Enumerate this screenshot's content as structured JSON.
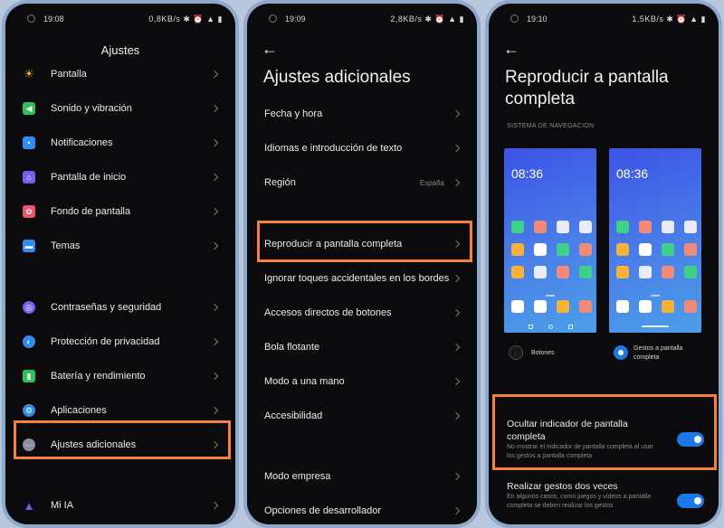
{
  "phone1": {
    "status": {
      "time": "19:08",
      "right": "0,8KB/s ✱ ⏰ ▲ ▮"
    },
    "title": "Ajustes",
    "items": [
      {
        "label": "Pantalla",
        "icon": "sun-icon",
        "color": "#f2b21b"
      },
      {
        "label": "Sonido y vibración",
        "icon": "speaker-icon",
        "color": "#2fbf5b"
      },
      {
        "label": "Notificaciones",
        "icon": "notification-icon",
        "color": "#2f8cf2"
      },
      {
        "label": "Pantalla de inicio",
        "icon": "home-icon",
        "color": "#7b5cf0"
      },
      {
        "label": "Fondo de pantalla",
        "icon": "flower-icon",
        "color": "#f0536a"
      },
      {
        "label": "Temas",
        "icon": "theme-icon",
        "color": "#2f8cf2"
      },
      {
        "label": "Contraseñas y seguridad",
        "icon": "fingerprint-icon",
        "color": "#7b5cf0"
      },
      {
        "label": "Protección de privacidad",
        "icon": "shield-icon",
        "color": "#2f8cf2"
      },
      {
        "label": "Batería y rendimiento",
        "icon": "battery-icon",
        "color": "#2fbf5b"
      },
      {
        "label": "Aplicaciones",
        "icon": "gear-icon",
        "color": "#2f8cf2"
      },
      {
        "label": "Ajustes adicionales",
        "icon": "more-icon",
        "color": "#8a8fa0"
      },
      {
        "label": "Mi IA",
        "icon": "ai-icon",
        "color": "#6b63f0"
      }
    ]
  },
  "phone2": {
    "status": {
      "time": "19:09",
      "right": "2,8KB/s ✱ ⏰ ▲ ▮"
    },
    "title": "Ajustes adicionales",
    "items": [
      {
        "label": "Fecha y hora",
        "value": ""
      },
      {
        "label": "Idiomas e introducción de texto",
        "value": ""
      },
      {
        "label": "Región",
        "value": "España"
      },
      {
        "label": "Reproducir a pantalla completa",
        "value": ""
      },
      {
        "label": "Ignorar toques accidentales en los bordes",
        "value": ""
      },
      {
        "label": "Accesos directos de botones",
        "value": ""
      },
      {
        "label": "Bola flotante",
        "value": ""
      },
      {
        "label": "Modo a una mano",
        "value": ""
      },
      {
        "label": "Accesibilidad",
        "value": ""
      },
      {
        "label": "Modo empresa",
        "value": ""
      },
      {
        "label": "Opciones de desarrollador",
        "value": ""
      }
    ]
  },
  "phone3": {
    "status": {
      "time": "19:10",
      "right": "1,5KB/s ✱ ⏰ ▲ ▮"
    },
    "title_line1": "Reproducir a pantalla",
    "title_line2": "completa",
    "section": "SISTEMA DE NAVEGACIÓN",
    "mock_time_left": "08:36",
    "mock_time_right": "08:36",
    "option_buttons": "Botones",
    "option_gestures_line1": "Gestos a pantalla",
    "option_gestures_line2": "completa",
    "selected_option": "Gestos a pantalla completa",
    "toggle1": {
      "title": "Ocultar indicador de pantalla completa",
      "desc": "No mostrar el indicador de pantalla completa al usar los gestos a pantalla completa",
      "on": true
    },
    "toggle2": {
      "title": "Realizar gestos dos veces",
      "desc": "En algunos casos, como juegos y vídeos a pantalla completa se deben realizar los gestos",
      "on": true
    }
  },
  "highlight_color": "#f5813c",
  "accent_color": "#1b79e6"
}
